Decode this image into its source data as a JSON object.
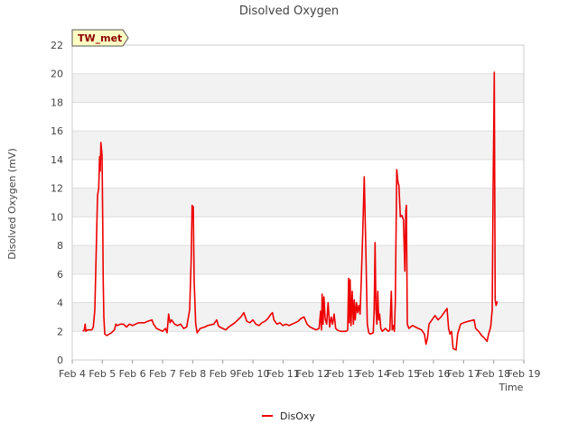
{
  "chart_data": {
    "type": "line",
    "title": "Disolved Oxygen",
    "xlabel": "Time",
    "ylabel": "Disolved Oxygen (mV)",
    "site_tag": "TW_met",
    "x_unit": "days since Feb 4",
    "xlim": [
      0,
      15
    ],
    "ylim": [
      0,
      22
    ],
    "x_ticks": [
      {
        "x": 0,
        "label": "Feb 4"
      },
      {
        "x": 1,
        "label": "Feb 5"
      },
      {
        "x": 2,
        "label": "Feb 6"
      },
      {
        "x": 3,
        "label": "Feb 7"
      },
      {
        "x": 4,
        "label": "Feb 8"
      },
      {
        "x": 5,
        "label": "Feb 9"
      },
      {
        "x": 6,
        "label": "Feb 10"
      },
      {
        "x": 7,
        "label": "Feb 11"
      },
      {
        "x": 8,
        "label": "Feb 12"
      },
      {
        "x": 9,
        "label": "Feb 13"
      },
      {
        "x": 10,
        "label": "Feb 14"
      },
      {
        "x": 11,
        "label": "Feb 15"
      },
      {
        "x": 12,
        "label": "Feb 16"
      },
      {
        "x": 13,
        "label": "Feb 17"
      },
      {
        "x": 14,
        "label": "Feb 18"
      },
      {
        "x": 15,
        "label": "Feb 19"
      }
    ],
    "y_ticks": [
      0,
      2,
      4,
      6,
      8,
      10,
      12,
      14,
      16,
      18,
      20,
      22
    ],
    "grid": true,
    "legend": "bottom-center",
    "series": [
      {
        "name": "DisOxy",
        "color": "#ee0000",
        "points": [
          [
            0.35,
            2.0
          ],
          [
            0.4,
            2.1
          ],
          [
            0.43,
            2.5
          ],
          [
            0.45,
            2.0
          ],
          [
            0.5,
            2.1
          ],
          [
            0.6,
            2.1
          ],
          [
            0.65,
            2.1
          ],
          [
            0.7,
            2.3
          ],
          [
            0.75,
            3.5
          ],
          [
            0.8,
            8.0
          ],
          [
            0.84,
            11.5
          ],
          [
            0.88,
            12.0
          ],
          [
            0.91,
            14.2
          ],
          [
            0.93,
            13.2
          ],
          [
            0.95,
            15.2
          ],
          [
            0.97,
            14.8
          ],
          [
            0.99,
            14.3
          ],
          [
            1.01,
            10.0
          ],
          [
            1.03,
            5.5
          ],
          [
            1.05,
            3.0
          ],
          [
            1.08,
            1.8
          ],
          [
            1.15,
            1.7
          ],
          [
            1.3,
            1.9
          ],
          [
            1.4,
            2.1
          ],
          [
            1.45,
            2.5
          ],
          [
            1.5,
            2.4
          ],
          [
            1.6,
            2.5
          ],
          [
            1.7,
            2.5
          ],
          [
            1.8,
            2.3
          ],
          [
            1.9,
            2.5
          ],
          [
            2.0,
            2.4
          ],
          [
            2.1,
            2.5
          ],
          [
            2.2,
            2.6
          ],
          [
            2.4,
            2.6
          ],
          [
            2.5,
            2.7
          ],
          [
            2.65,
            2.8
          ],
          [
            2.7,
            2.5
          ],
          [
            2.8,
            2.2
          ],
          [
            2.9,
            2.1
          ],
          [
            3.0,
            2.0
          ],
          [
            3.1,
            2.2
          ],
          [
            3.15,
            1.9
          ],
          [
            3.2,
            3.2
          ],
          [
            3.25,
            2.6
          ],
          [
            3.3,
            2.8
          ],
          [
            3.4,
            2.5
          ],
          [
            3.5,
            2.4
          ],
          [
            3.6,
            2.5
          ],
          [
            3.7,
            2.2
          ],
          [
            3.8,
            2.3
          ],
          [
            3.9,
            3.5
          ],
          [
            3.95,
            7.0
          ],
          [
            3.98,
            10.8
          ],
          [
            4.02,
            10.7
          ],
          [
            4.05,
            5.5
          ],
          [
            4.1,
            2.5
          ],
          [
            4.15,
            1.9
          ],
          [
            4.25,
            2.2
          ],
          [
            4.4,
            2.3
          ],
          [
            4.5,
            2.4
          ],
          [
            4.7,
            2.5
          ],
          [
            4.8,
            2.8
          ],
          [
            4.85,
            2.4
          ],
          [
            4.9,
            2.3
          ],
          [
            5.0,
            2.2
          ],
          [
            5.1,
            2.1
          ],
          [
            5.2,
            2.3
          ],
          [
            5.4,
            2.6
          ],
          [
            5.6,
            3.0
          ],
          [
            5.7,
            3.3
          ],
          [
            5.8,
            2.7
          ],
          [
            5.9,
            2.6
          ],
          [
            6.0,
            2.8
          ],
          [
            6.1,
            2.5
          ],
          [
            6.2,
            2.4
          ],
          [
            6.3,
            2.6
          ],
          [
            6.4,
            2.7
          ],
          [
            6.5,
            2.9
          ],
          [
            6.6,
            3.2
          ],
          [
            6.65,
            3.3
          ],
          [
            6.7,
            2.8
          ],
          [
            6.8,
            2.5
          ],
          [
            6.9,
            2.6
          ],
          [
            7.0,
            2.4
          ],
          [
            7.1,
            2.5
          ],
          [
            7.2,
            2.4
          ],
          [
            7.4,
            2.6
          ],
          [
            7.5,
            2.7
          ],
          [
            7.6,
            2.9
          ],
          [
            7.7,
            3.0
          ],
          [
            7.8,
            2.5
          ],
          [
            7.9,
            2.3
          ],
          [
            8.0,
            2.2
          ],
          [
            8.1,
            2.1
          ],
          [
            8.2,
            2.2
          ],
          [
            8.25,
            3.4
          ],
          [
            8.28,
            2.1
          ],
          [
            8.3,
            4.6
          ],
          [
            8.33,
            2.5
          ],
          [
            8.36,
            4.4
          ],
          [
            8.4,
            2.9
          ],
          [
            8.45,
            2.5
          ],
          [
            8.5,
            4.0
          ],
          [
            8.55,
            2.3
          ],
          [
            8.6,
            3.0
          ],
          [
            8.65,
            2.5
          ],
          [
            8.7,
            3.2
          ],
          [
            8.75,
            2.2
          ],
          [
            8.8,
            2.1
          ],
          [
            8.9,
            2.0
          ],
          [
            9.0,
            2.0
          ],
          [
            9.1,
            2.0
          ],
          [
            9.15,
            2.1
          ],
          [
            9.18,
            5.7
          ],
          [
            9.2,
            2.6
          ],
          [
            9.23,
            5.6
          ],
          [
            9.26,
            2.4
          ],
          [
            9.3,
            4.8
          ],
          [
            9.34,
            2.5
          ],
          [
            9.37,
            4.2
          ],
          [
            9.4,
            2.8
          ],
          [
            9.44,
            4.0
          ],
          [
            9.48,
            3.3
          ],
          [
            9.52,
            3.8
          ],
          [
            9.56,
            3.2
          ],
          [
            9.6,
            5.5
          ],
          [
            9.65,
            9.0
          ],
          [
            9.7,
            12.8
          ],
          [
            9.75,
            8.0
          ],
          [
            9.8,
            2.5
          ],
          [
            9.85,
            1.9
          ],
          [
            9.9,
            1.8
          ],
          [
            10.0,
            1.9
          ],
          [
            10.03,
            3.5
          ],
          [
            10.06,
            8.2
          ],
          [
            10.09,
            3.5
          ],
          [
            10.12,
            2.5
          ],
          [
            10.15,
            4.8
          ],
          [
            10.18,
            2.8
          ],
          [
            10.21,
            3.2
          ],
          [
            10.25,
            2.2
          ],
          [
            10.3,
            2.0
          ],
          [
            10.4,
            2.2
          ],
          [
            10.5,
            2.0
          ],
          [
            10.55,
            2.1
          ],
          [
            10.6,
            4.8
          ],
          [
            10.63,
            2.1
          ],
          [
            10.67,
            2.4
          ],
          [
            10.7,
            2.0
          ],
          [
            10.73,
            4.0
          ],
          [
            10.78,
            13.3
          ],
          [
            10.82,
            12.4
          ],
          [
            10.85,
            12.2
          ],
          [
            10.9,
            10.0
          ],
          [
            10.95,
            10.1
          ],
          [
            11.0,
            9.8
          ],
          [
            11.05,
            6.2
          ],
          [
            11.08,
            10.4
          ],
          [
            11.1,
            10.8
          ],
          [
            11.13,
            2.5
          ],
          [
            11.18,
            2.2
          ],
          [
            11.3,
            2.4
          ],
          [
            11.4,
            2.3
          ],
          [
            11.5,
            2.2
          ],
          [
            11.6,
            2.1
          ],
          [
            11.7,
            1.8
          ],
          [
            11.75,
            1.1
          ],
          [
            11.8,
            1.5
          ],
          [
            11.85,
            2.5
          ],
          [
            11.95,
            2.8
          ],
          [
            12.05,
            3.1
          ],
          [
            12.15,
            2.8
          ],
          [
            12.25,
            3.0
          ],
          [
            12.35,
            3.3
          ],
          [
            12.45,
            3.6
          ],
          [
            12.5,
            2.2
          ],
          [
            12.55,
            1.8
          ],
          [
            12.6,
            2.0
          ],
          [
            12.65,
            0.8
          ],
          [
            12.75,
            0.7
          ],
          [
            12.8,
            1.8
          ],
          [
            12.9,
            2.5
          ],
          [
            13.0,
            2.6
          ],
          [
            13.15,
            2.7
          ],
          [
            13.35,
            2.8
          ],
          [
            13.4,
            2.2
          ],
          [
            13.5,
            2.0
          ],
          [
            13.6,
            1.7
          ],
          [
            13.7,
            1.5
          ],
          [
            13.78,
            1.3
          ],
          [
            13.83,
            1.8
          ],
          [
            13.9,
            2.3
          ],
          [
            13.95,
            3.5
          ],
          [
            13.98,
            12.0
          ],
          [
            14.0,
            16.0
          ],
          [
            14.02,
            20.1
          ],
          [
            14.05,
            4.2
          ],
          [
            14.08,
            3.8
          ],
          [
            14.12,
            4.1
          ]
        ]
      }
    ]
  }
}
